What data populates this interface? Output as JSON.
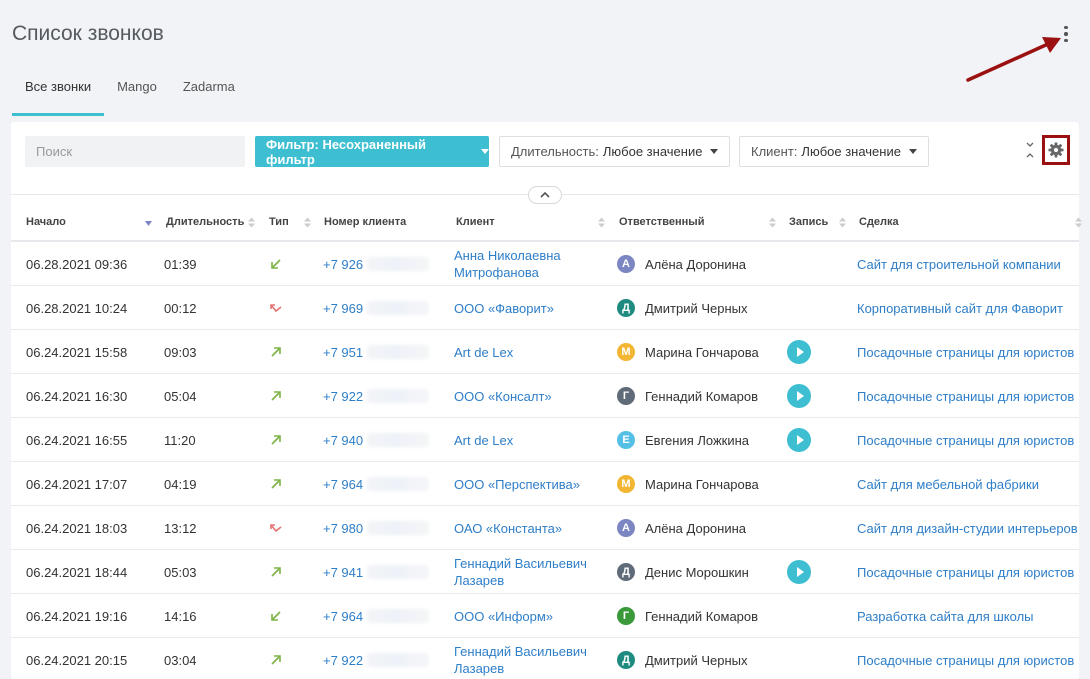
{
  "page": {
    "title": "Список звонков"
  },
  "tabs": [
    "Все звонки",
    "Mango",
    "Zadarma"
  ],
  "toolbar": {
    "search_placeholder": "Поиск",
    "filter_label": "Фильтр: Несохраненный фильтр",
    "duration_label": "Длительность:",
    "duration_value": "Любое значение",
    "client_label": "Клиент:",
    "client_value": "Любое значение"
  },
  "table": {
    "columns": [
      "Начало",
      "Длительность",
      "Тип",
      "Номер клиента",
      "Клиент",
      "Ответственный",
      "Запись",
      "Сделка"
    ],
    "rows": [
      {
        "start": "06.28.2021 09:36",
        "duration": "01:39",
        "type": "incoming",
        "phone": "+7 926",
        "client": "Анна Николаевна Митрофанова",
        "owner": "Алёна Доронина",
        "initial": "А",
        "avatar_color": "#7b86c2",
        "record": false,
        "deal": "Сайт для строительной компании"
      },
      {
        "start": "06.28.2021 10:24",
        "duration": "00:12",
        "type": "missed",
        "phone": "+7 969",
        "client": "ООО «Фаворит»",
        "owner": "Дмитрий Черных",
        "initial": "Д",
        "avatar_color": "#1f8a80",
        "record": false,
        "deal": "Корпоративный сайт для Фаворит"
      },
      {
        "start": "06.24.2021 15:58",
        "duration": "09:03",
        "type": "outgoing",
        "phone": "+7 951",
        "client": "Art de Lex",
        "owner": "Марина Гончарова",
        "initial": "М",
        "avatar_color": "#f2b632",
        "record": true,
        "deal": "Посадочные страницы для юристов"
      },
      {
        "start": "06.24.2021 16:30",
        "duration": "05:04",
        "type": "outgoing",
        "phone": "+7 922",
        "client": "ООО «Консалт»",
        "owner": "Геннадий Комаров",
        "initial": "Г",
        "avatar_color": "#5f6b78",
        "record": true,
        "deal": "Посадочные страницы для юристов"
      },
      {
        "start": "06.24.2021 16:55",
        "duration": "11:20",
        "type": "outgoing",
        "phone": "+7 940",
        "client": "Art de Lex",
        "owner": "Евгения Ложкина",
        "initial": "Е",
        "avatar_color": "#56bfe6",
        "record": true,
        "deal": "Посадочные страницы для юристов"
      },
      {
        "start": "06.24.2021 17:07",
        "duration": "04:19",
        "type": "outgoing",
        "phone": "+7 964",
        "client": "ООО «Перспектива»",
        "owner": "Марина Гончарова",
        "initial": "М",
        "avatar_color": "#f2b632",
        "record": false,
        "deal": "Сайт для мебельной фабрики"
      },
      {
        "start": "06.24.2021 18:03",
        "duration": "13:12",
        "type": "missed",
        "phone": "+7 980",
        "client": "ОАО «Константа»",
        "owner": "Алёна Доронина",
        "initial": "А",
        "avatar_color": "#7b86c2",
        "record": false,
        "deal": "Сайт для дизайн-студии интерьеров"
      },
      {
        "start": "06.24.2021 18:44",
        "duration": "05:03",
        "type": "outgoing",
        "phone": "+7 941",
        "client": "Геннадий Васильевич Лазарев",
        "owner": "Денис Морошкин",
        "initial": "Д",
        "avatar_color": "#5f6b78",
        "record": true,
        "deal": "Посадочные страницы для юристов"
      },
      {
        "start": "06.24.2021 19:16",
        "duration": "14:16",
        "type": "incoming",
        "phone": "+7 964",
        "client": "ООО «Информ»",
        "owner": "Геннадий Комаров",
        "initial": "Г",
        "avatar_color": "#3a9a3a",
        "record": false,
        "deal": "Разработка сайта для школы"
      },
      {
        "start": "06.24.2021 20:15",
        "duration": "03:04",
        "type": "outgoing",
        "phone": "+7 922",
        "client": "Геннадий Васильевич Лазарев",
        "owner": "Дмитрий Черных",
        "initial": "Д",
        "avatar_color": "#1f8a80",
        "record": false,
        "deal": "Посадочные страницы для юристов"
      }
    ]
  },
  "colors": {
    "accent": "#3dbfd1",
    "link": "#2e7ec8",
    "annotation": "#9b1111",
    "incoming": "#7cb342",
    "missed": "#e57373"
  },
  "icons": [
    "more-vertical-icon",
    "gear-icon",
    "collapse-icon",
    "chevron-up-icon",
    "play-icon",
    "incoming-call-icon",
    "missed-call-icon",
    "outgoing-call-icon",
    "sort-icon",
    "annotation-arrow-icon"
  ]
}
